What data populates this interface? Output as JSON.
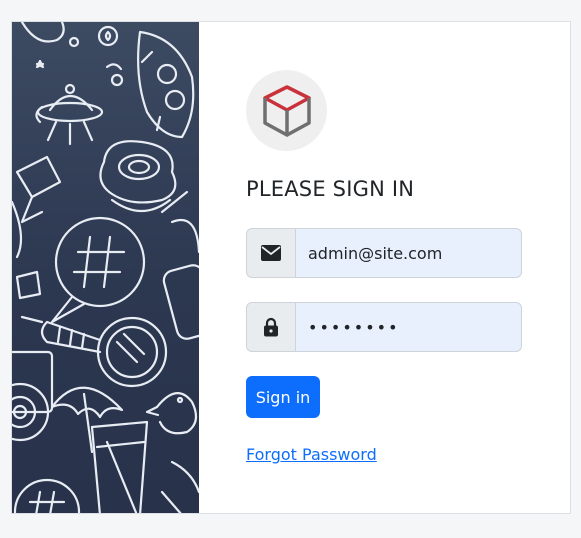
{
  "login": {
    "heading": "PLEASE SIGN IN",
    "email_value": "admin@site.com",
    "password_value": "••••••••",
    "submit_label": "Sign in",
    "forgot_label": "Forgot Password"
  },
  "icons": {
    "logo": "cube-logo-icon",
    "email": "envelope-icon",
    "password": "lock-icon"
  },
  "colors": {
    "primary": "#0d6efd",
    "side_panel": "#2f3b55",
    "input_fill": "#e8f0fe",
    "logo_red": "#c9323b",
    "logo_grey": "#6f6f6f"
  }
}
